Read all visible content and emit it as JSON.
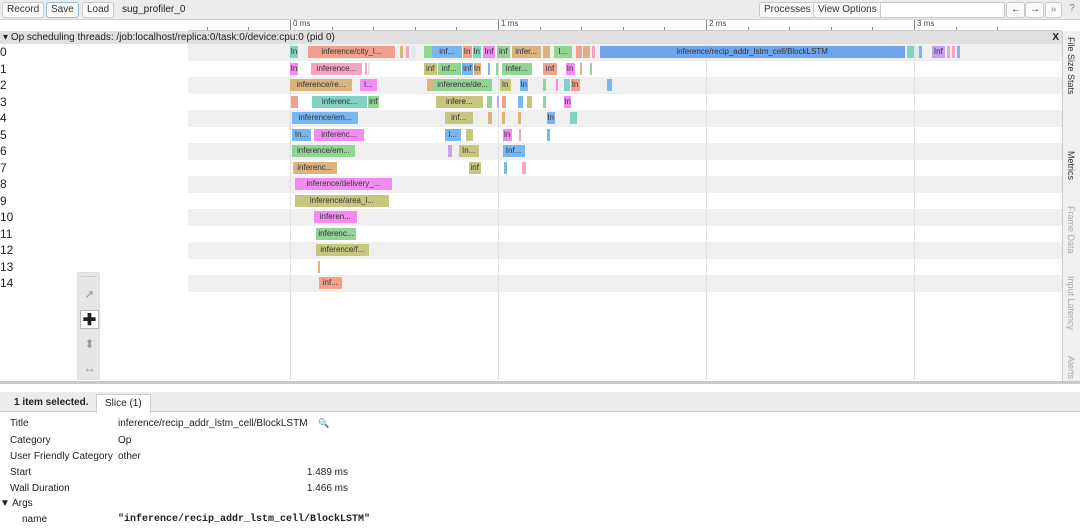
{
  "toolbar": {
    "record": "Record",
    "save": "Save",
    "load": "Load",
    "title": "sug_profiler_0",
    "processes": "Processes",
    "view_options": "View Options",
    "search_value": "",
    "prev": "←",
    "next": "→",
    "more": "»",
    "help": "?"
  },
  "ruler": {
    "labels": [
      "0 ms",
      "1 ms",
      "2 ms",
      "3 ms"
    ]
  },
  "track": {
    "title": "Op scheduling threads: /job:localhost/replica:0/task:0/device:cpu:0 (pid 0)",
    "close": "X",
    "rows": [
      "0",
      "1",
      "2",
      "3",
      "4",
      "5",
      "6",
      "7",
      "8",
      "9",
      "10",
      "11",
      "12",
      "13",
      "14"
    ]
  },
  "palette": {
    "teal": "#80d2c2",
    "salmon": "#f2a08c",
    "blue": "#78b6f2",
    "magenta": "#f28cf0",
    "green": "#92d492",
    "olive": "#c6c67e",
    "tan": "#dcb27e",
    "purple": "#c8a2f2",
    "pink": "#f6a2c2",
    "lstm": "#6ea6ee",
    "light": "#dde8e0"
  },
  "slices_us": [
    [
      0,
      0,
      38,
      "teal",
      "In"
    ],
    [
      0,
      86,
      418,
      "salmon",
      "inference/city_l..."
    ],
    [
      0,
      528,
      14,
      "tan",
      ""
    ],
    [
      0,
      557,
      14,
      "pink",
      ""
    ],
    [
      0,
      586,
      14,
      "light",
      ""
    ],
    [
      0,
      643,
      38,
      "green",
      ""
    ],
    [
      0,
      682,
      144,
      "blue",
      "inf..."
    ],
    [
      0,
      830,
      43,
      "salmon",
      "In"
    ],
    [
      0,
      878,
      38,
      "teal",
      "In"
    ],
    [
      0,
      926,
      62,
      "magenta",
      "Inf"
    ],
    [
      0,
      994,
      62,
      "green",
      "inf"
    ],
    [
      0,
      1066,
      139,
      "tan",
      "infer..."
    ],
    [
      0,
      1214,
      34,
      "tan",
      ""
    ],
    [
      0,
      1267,
      91,
      "green",
      "l..."
    ],
    [
      0,
      1373,
      29,
      "salmon",
      ""
    ],
    [
      0,
      1411,
      29,
      "tan",
      ""
    ],
    [
      0,
      1450,
      14,
      "pink",
      ""
    ],
    [
      0,
      1489,
      1466,
      "lstm",
      "inference/recip_addr_lstm_cell/BlockLSTM"
    ],
    [
      0,
      2966,
      34,
      "teal",
      ""
    ],
    [
      0,
      3005,
      19,
      "light",
      ""
    ],
    [
      0,
      3024,
      14,
      "blue",
      ""
    ],
    [
      0,
      3086,
      62,
      "purple",
      "Inf"
    ],
    [
      0,
      3158,
      14,
      "pink",
      ""
    ],
    [
      0,
      3182,
      14,
      "pink",
      ""
    ],
    [
      0,
      3206,
      14,
      "blue",
      ""
    ],
    [
      1,
      0,
      38,
      "magenta",
      "In"
    ],
    [
      1,
      101,
      245,
      "pink",
      "inference..."
    ],
    [
      1,
      360,
      10,
      "pink",
      ""
    ],
    [
      1,
      375,
      10,
      "light",
      ""
    ],
    [
      1,
      643,
      62,
      "olive",
      "inf"
    ],
    [
      1,
      710,
      110,
      "green",
      "inf..."
    ],
    [
      1,
      826,
      53,
      "blue",
      "inf"
    ],
    [
      1,
      883,
      34,
      "tan",
      "In"
    ],
    [
      1,
      950,
      10,
      "blue",
      ""
    ],
    [
      1,
      989,
      10,
      "green",
      ""
    ],
    [
      1,
      1018,
      144,
      "green",
      "infer..."
    ],
    [
      1,
      1214,
      72,
      "salmon",
      "inf"
    ],
    [
      1,
      1325,
      43,
      "magenta",
      "In"
    ],
    [
      1,
      1392,
      14,
      "tan",
      ""
    ],
    [
      1,
      1440,
      14,
      "green",
      ""
    ],
    [
      2,
      0,
      298,
      "tan",
      "inference/re..."
    ],
    [
      2,
      336,
      82,
      "magenta",
      "l..."
    ],
    [
      2,
      658,
      34,
      "tan",
      ""
    ],
    [
      2,
      691,
      278,
      "green",
      "inference/de..."
    ],
    [
      2,
      1008,
      53,
      "olive",
      "In"
    ],
    [
      2,
      1104,
      38,
      "blue",
      "In"
    ],
    [
      2,
      1214,
      19,
      "green",
      ""
    ],
    [
      2,
      1277,
      10,
      "magenta",
      ""
    ],
    [
      2,
      1315,
      29,
      "teal",
      ""
    ],
    [
      2,
      1349,
      43,
      "salmon",
      "In"
    ],
    [
      2,
      1522,
      24,
      "blue",
      ""
    ],
    [
      3,
      5,
      34,
      "salmon",
      ""
    ],
    [
      3,
      106,
      264,
      "teal",
      "inferenc..."
    ],
    [
      3,
      374,
      53,
      "green",
      "inf"
    ],
    [
      3,
      701,
      226,
      "olive",
      "infere..."
    ],
    [
      3,
      946,
      24,
      "green",
      ""
    ],
    [
      3,
      994,
      10,
      "purple",
      ""
    ],
    [
      3,
      1018,
      19,
      "salmon",
      ""
    ],
    [
      3,
      1094,
      24,
      "blue",
      ""
    ],
    [
      3,
      1138,
      24,
      "olive",
      ""
    ],
    [
      3,
      1214,
      19,
      "green",
      ""
    ],
    [
      3,
      1315,
      38,
      "magenta",
      "In"
    ],
    [
      4,
      10,
      317,
      "blue",
      "inference/em..."
    ],
    [
      4,
      744,
      134,
      "olive",
      "inf..."
    ],
    [
      4,
      950,
      19,
      "tan",
      ""
    ],
    [
      4,
      1018,
      14,
      "tan",
      ""
    ],
    [
      4,
      1094,
      19,
      "tan",
      ""
    ],
    [
      4,
      1234,
      38,
      "blue",
      "In"
    ],
    [
      4,
      1344,
      34,
      "teal",
      ""
    ],
    [
      5,
      10,
      91,
      "blue",
      "In..."
    ],
    [
      5,
      115,
      240,
      "magenta",
      "inferenc..."
    ],
    [
      5,
      744,
      77,
      "blue",
      "l..."
    ],
    [
      5,
      845,
      34,
      "olive",
      ""
    ],
    [
      5,
      1022,
      43,
      "magenta",
      "In"
    ],
    [
      5,
      1099,
      14,
      "pink",
      ""
    ],
    [
      5,
      1234,
      14,
      "blue",
      ""
    ],
    [
      6,
      10,
      302,
      "green",
      "inference/em..."
    ],
    [
      6,
      758,
      19,
      "purple",
      ""
    ],
    [
      6,
      811,
      96,
      "olive",
      "In..."
    ],
    [
      6,
      1022,
      106,
      "blue",
      "Inf..."
    ],
    [
      7,
      14,
      211,
      "tan",
      "inferenc..."
    ],
    [
      7,
      859,
      58,
      "olive",
      "inf"
    ],
    [
      7,
      1027,
      14,
      "blue",
      ""
    ],
    [
      7,
      1114,
      19,
      "pink",
      ""
    ],
    [
      8,
      24,
      466,
      "magenta",
      "inference/delivery_..."
    ],
    [
      9,
      24,
      451,
      "olive",
      "inference/area_l..."
    ],
    [
      10,
      115,
      206,
      "magenta",
      "inferen..."
    ],
    [
      11,
      125,
      192,
      "green",
      "inferenc..."
    ],
    [
      12,
      125,
      254,
      "olive",
      "inference/f..."
    ],
    [
      13,
      134,
      10,
      "tan",
      ""
    ],
    [
      14,
      139,
      110,
      "salmon",
      "inf..."
    ]
  ],
  "side_tabs": [
    "File Size Stats",
    "Metrics",
    "Frame Data",
    "Input Latency",
    "Alerts"
  ],
  "details": {
    "selected": "1 item selected.",
    "tab": "Slice (1)",
    "title_label": "Title",
    "title_value": "inference/recip_addr_lstm_cell/BlockLSTM",
    "category_label": "Category",
    "category_value": "Op",
    "ufc_label": "User Friendly Category",
    "ufc_value": "other",
    "start_label": "Start",
    "start_value": "1.489 ms",
    "wall_label": "Wall Duration",
    "wall_value": "1.466 ms",
    "args_label": "Args",
    "arg_name_label": "name",
    "arg_name_value": "\"inference/recip_addr_lstm_cell/BlockLSTM\""
  }
}
